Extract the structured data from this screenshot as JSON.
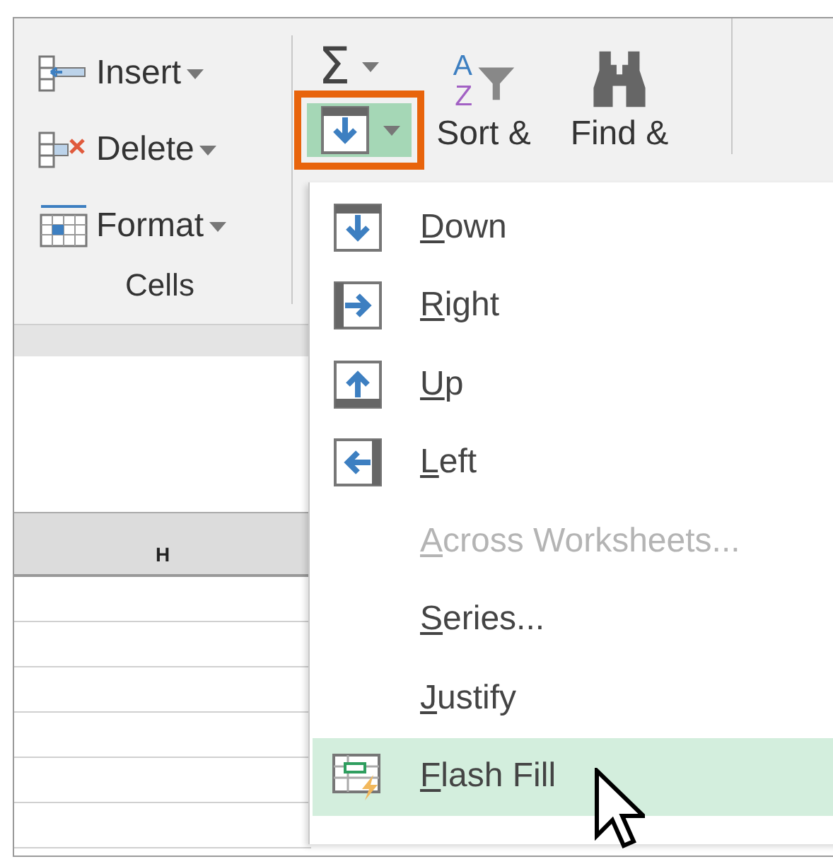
{
  "ribbon": {
    "cells_group": {
      "label": "Cells",
      "commands": [
        {
          "label": "Insert",
          "kind": "insert"
        },
        {
          "label": "Delete",
          "kind": "delete"
        },
        {
          "label": "Format",
          "kind": "format"
        }
      ]
    },
    "editing": {
      "autosum": "Σ",
      "fill_button": {
        "selected": true
      },
      "sort_icon": {
        "top": "A",
        "bottom": "Z"
      },
      "sort_label": "Sort &",
      "find_label": "Find &"
    }
  },
  "sheet": {
    "column_header": "H"
  },
  "fill_menu": {
    "items": [
      {
        "label": "Down",
        "kind": "down",
        "disabled": false,
        "selected": false
      },
      {
        "label": "Right",
        "kind": "right",
        "disabled": false,
        "selected": false
      },
      {
        "label": "Up",
        "kind": "up",
        "disabled": false,
        "selected": false
      },
      {
        "label": "Left",
        "kind": "left",
        "disabled": false,
        "selected": false
      },
      {
        "label": "Across Worksheets...",
        "kind": "none",
        "disabled": true,
        "selected": false
      },
      {
        "label": "Series...",
        "kind": "none",
        "disabled": false,
        "selected": false
      },
      {
        "label": "Justify",
        "kind": "none",
        "disabled": false,
        "selected": false
      },
      {
        "label": "Flash Fill",
        "kind": "flash",
        "disabled": false,
        "selected": true
      }
    ]
  }
}
